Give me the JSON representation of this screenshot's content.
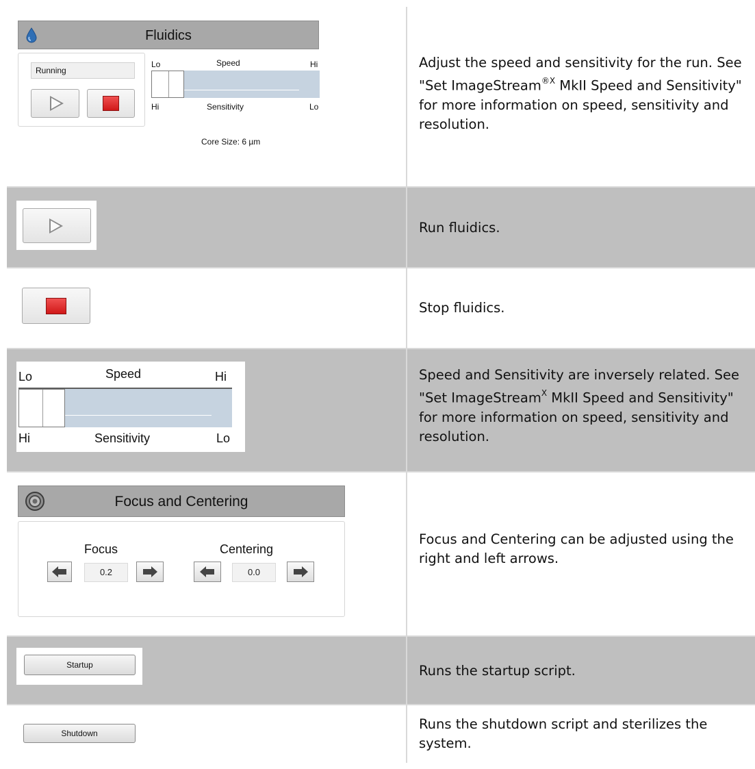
{
  "rows": {
    "fluidics": {
      "panel_title": "Fluidics",
      "status": "Running",
      "speed_label": "Speed",
      "sensitivity_label": "Sensitivity",
      "lo": "Lo",
      "hi": "Hi",
      "core_size": "Core Size: 6 µm",
      "slider_level": 0.0,
      "desc_1": "Adjust the speed and sensitivity for the run. See \"Set ImageStream",
      "desc_sup": "®X",
      "desc_2": " MkII Speed and Sensitivity\" for more information on speed, sensitivity and resolution."
    },
    "run": {
      "desc": "Run fluidics."
    },
    "stop": {
      "desc": "Stop fluidics."
    },
    "slider": {
      "lo": "Lo",
      "hi": "Hi",
      "speed_label": "Speed",
      "sensitivity_label": "Sensitivity",
      "slider_level": 0.0,
      "desc_1": "Speed and Sensitivity are inversely related. See \"Set ImageStream",
      "desc_sup": "X",
      "desc_2": " MkII Speed and Sensitivity\" for more information on speed, sensitivity and resolution."
    },
    "focus": {
      "panel_title": "Focus and Centering",
      "focus_label": "Focus",
      "centering_label": "Centering",
      "focus_value": "0.2",
      "centering_value": "0.0",
      "desc": "Focus and Centering can be adjusted using the right and left arrows."
    },
    "startup": {
      "button_label": "Startup",
      "desc": "Runs the startup script."
    },
    "shutdown": {
      "button_label": "Shutdown",
      "desc": "Runs the shutdown script and sterilizes the system."
    }
  },
  "colors": {
    "row_gray": "#bfbfbf",
    "stop_red": "#e02020",
    "slider_track": "#c6d3e0",
    "fluid_drop": "#2f6fb5"
  },
  "icons": [
    "water-drop-icon",
    "play-icon",
    "stop-icon",
    "focus-target-icon",
    "left-arrow-icon",
    "right-arrow-icon"
  ]
}
